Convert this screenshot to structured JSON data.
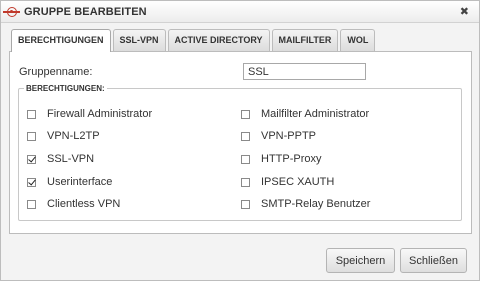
{
  "dialog": {
    "title": "GRUPPE BEARBEITEN",
    "icons": {
      "title": "logo-icon",
      "close": "close-icon"
    },
    "close_glyph": "✖"
  },
  "tabs": [
    {
      "label": "BERECHTIGUNGEN",
      "active": true
    },
    {
      "label": "SSL-VPN",
      "active": false
    },
    {
      "label": "ACTIVE DIRECTORY",
      "active": false
    },
    {
      "label": "MAILFILTER",
      "active": false
    },
    {
      "label": "WOL",
      "active": false
    }
  ],
  "form": {
    "group_name_label": "Gruppenname:",
    "group_name_value": "SSL",
    "permissions_legend": "BERECHTIGUNGEN:"
  },
  "permissions": [
    {
      "label": "Firewall Administrator",
      "checked": false
    },
    {
      "label": "Mailfilter Administrator",
      "checked": false
    },
    {
      "label": "VPN-L2TP",
      "checked": false
    },
    {
      "label": "VPN-PPTP",
      "checked": false
    },
    {
      "label": "SSL-VPN",
      "checked": true
    },
    {
      "label": "HTTP-Proxy",
      "checked": false
    },
    {
      "label": "Userinterface",
      "checked": true
    },
    {
      "label": "IPSEC XAUTH",
      "checked": false
    },
    {
      "label": "Clientless VPN",
      "checked": false
    },
    {
      "label": "SMTP-Relay Benutzer",
      "checked": false
    }
  ],
  "buttons": {
    "save": "Speichern",
    "close": "Schließen"
  }
}
